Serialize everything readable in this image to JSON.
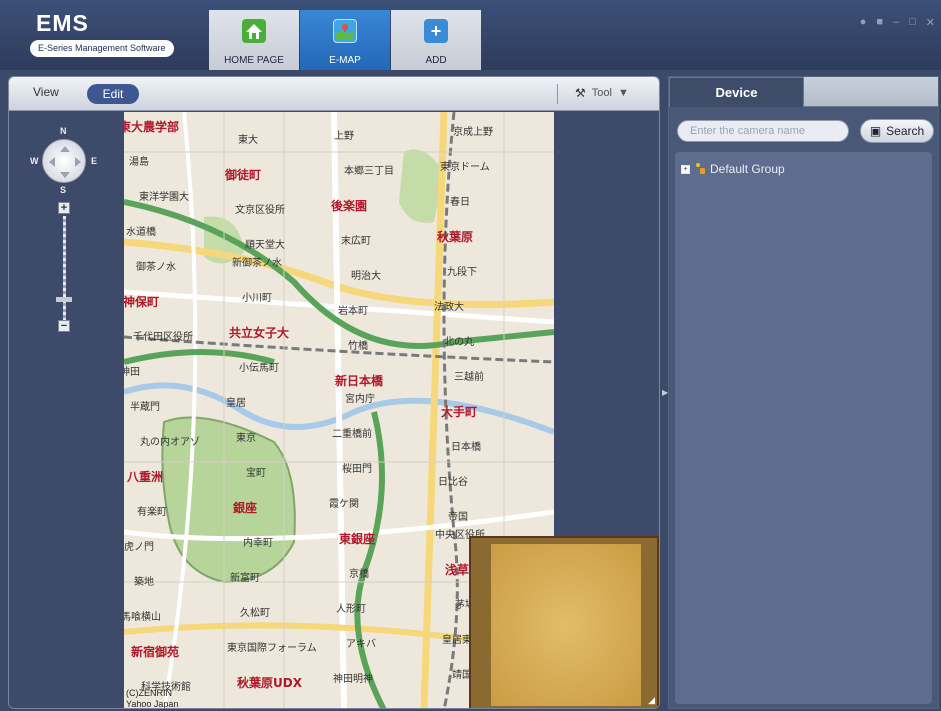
{
  "app": {
    "title": "EMS",
    "subtitle": "E-Series Management Software"
  },
  "nav": {
    "tabs": [
      {
        "label": "HOME PAGE",
        "icon": "home-icon"
      },
      {
        "label": "E-MAP",
        "icon": "map-icon",
        "active": true
      },
      {
        "label": "ADD",
        "icon": "plus-icon"
      }
    ]
  },
  "window_controls": [
    "user-icon",
    "lock-icon",
    "minimize-icon",
    "maximize-icon",
    "close-icon"
  ],
  "map_toolbar": {
    "view_label": "View",
    "edit_label": "Edit",
    "tool_label": "Tool"
  },
  "compass": {
    "n": "N",
    "s": "S",
    "e": "E",
    "w": "W"
  },
  "zoom": {
    "plus": "+",
    "minus": "−",
    "level_fraction": 0.8
  },
  "map": {
    "labels": [
      "東大農学部",
      "東大",
      "上野",
      "京成上野",
      "湯島",
      "御徒町",
      "本郷三丁目",
      "東京ドーム",
      "東洋学園大",
      "文京区役所",
      "後楽園",
      "春日",
      "水道橋",
      "順天堂大",
      "末広町",
      "秋葉原",
      "御茶ノ水",
      "新御茶ノ水",
      "明治大",
      "九段下",
      "神保町",
      "小川町",
      "岩本町",
      "法政大",
      "千代田区役所",
      "共立女子大",
      "竹橋",
      "北の丸",
      "神田",
      "小伝馬町",
      "新日本橋",
      "三越前",
      "半蔵門",
      "皇居",
      "宮内庁",
      "大手町",
      "丸の内オアゾ",
      "東京",
      "二重橋前",
      "日本橋",
      "八重洲",
      "宝町",
      "桜田門",
      "日比谷",
      "有楽町",
      "銀座",
      "霞ケ関",
      "帝国",
      "虎ノ門",
      "内幸町",
      "東銀座",
      "中央区役所",
      "築地",
      "新富町",
      "京橋",
      "浅草橋",
      "馬喰横山",
      "久松町",
      "人形町",
      "茅場町",
      "新宿御苑",
      "東京国際フォーラム",
      "アキバ",
      "皇居東御苑",
      "科学技術館",
      "秋葉原UDX",
      "神田明神",
      "靖国神社"
    ],
    "copyright": "(C)ZENRIN",
    "attribution": "Yahoo Japan"
  },
  "device_panel": {
    "tab_label": "Device",
    "search_placeholder": "Enter the camera name",
    "search_label": "Search",
    "tree": [
      {
        "label": "Default Group",
        "expanded": false
      }
    ]
  }
}
